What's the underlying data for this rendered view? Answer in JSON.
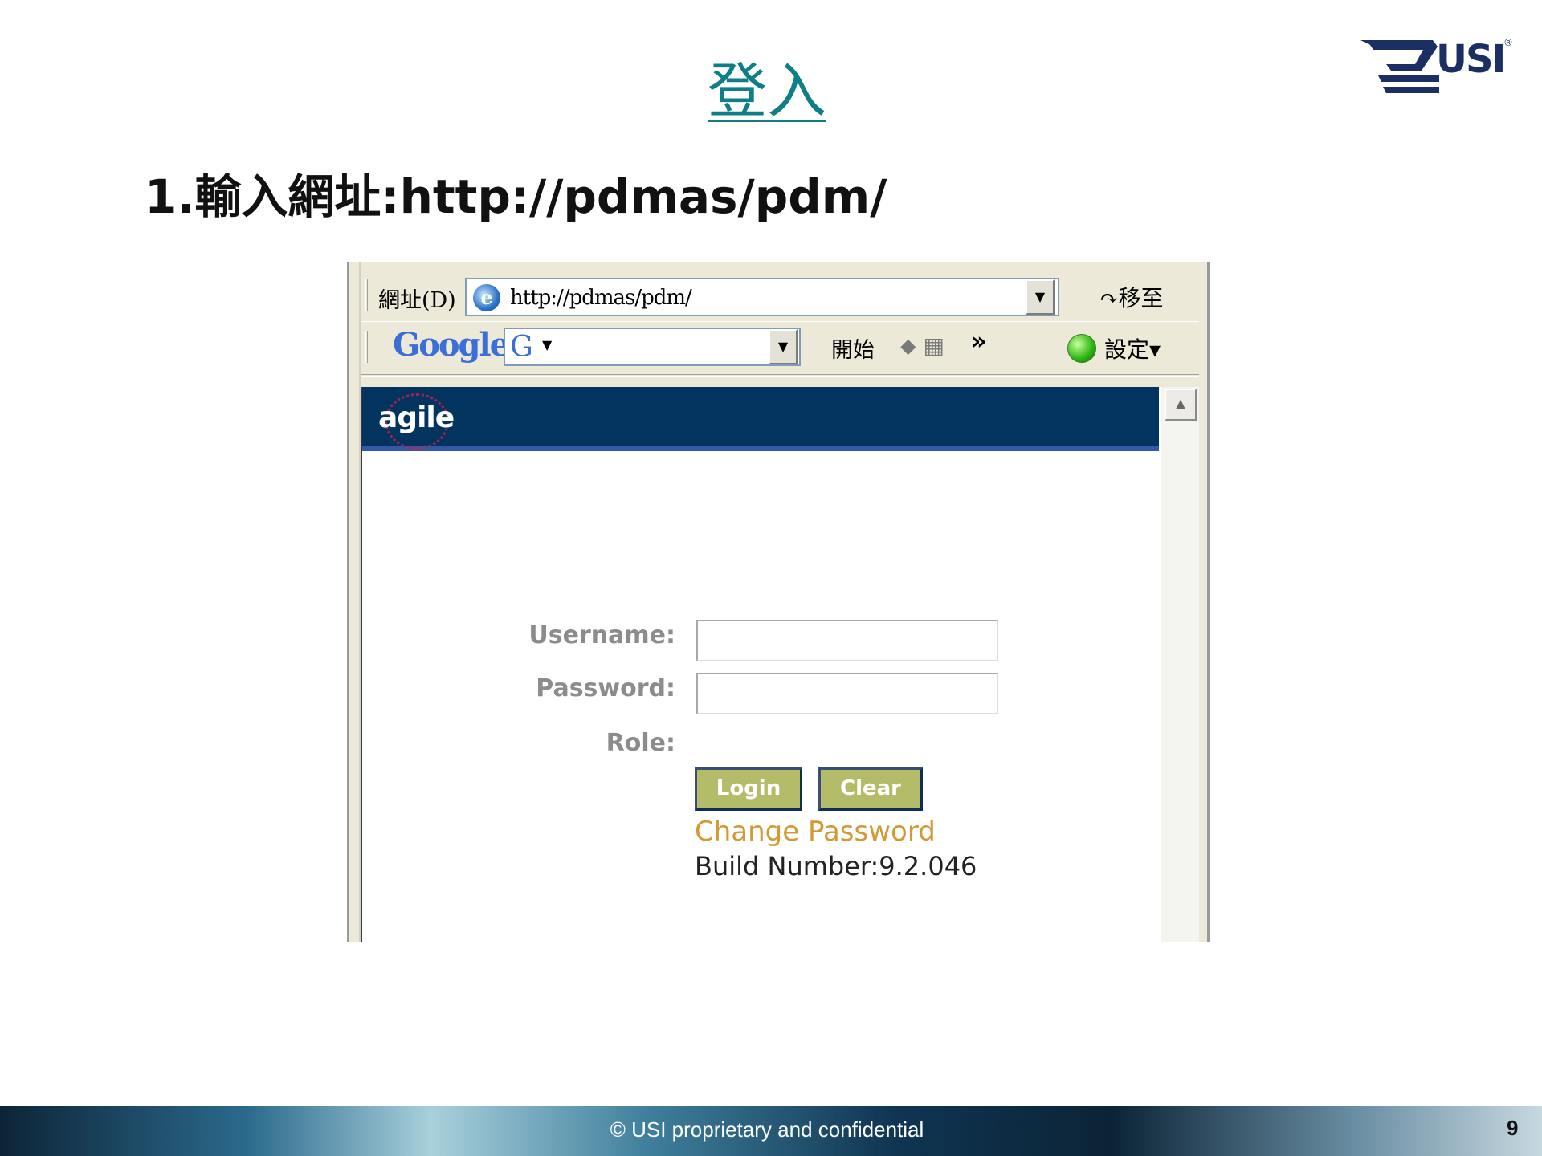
{
  "slide": {
    "title": "登入",
    "step_heading": "1.輸入網址:http://pdmas/pdm/",
    "logo_text": "USI",
    "logo_mark": "®",
    "footer_text": "© USI proprietary and confidential",
    "page_number": "9"
  },
  "browser": {
    "address_label": "網址(D)",
    "url": "http://pdmas/pdm/",
    "go_label": "↷移至",
    "google": {
      "logo": "Google",
      "search_icon": "G",
      "search_value": "",
      "start_label": "開始",
      "more_label": "»",
      "settings_label": "設定▾"
    }
  },
  "app": {
    "brand": "agile",
    "username_label": "Username:",
    "password_label": "Password:",
    "role_label": "Role:",
    "username_value": "",
    "password_value": "",
    "login_button": "Login",
    "clear_button": "Clear",
    "change_password": "Change Password",
    "build_number": "Build Number:9.2.046"
  },
  "colors": {
    "title": "#0f7f86",
    "agile_header": "#03345f",
    "button": "#b4bc6a",
    "link": "#d29a35"
  },
  "icons": [
    "ie-icon",
    "dropdown-arrow-icon",
    "go-arrow-icon",
    "google-g-icon",
    "toolbar-icons",
    "green-status-icon",
    "scroll-up-icon"
  ]
}
